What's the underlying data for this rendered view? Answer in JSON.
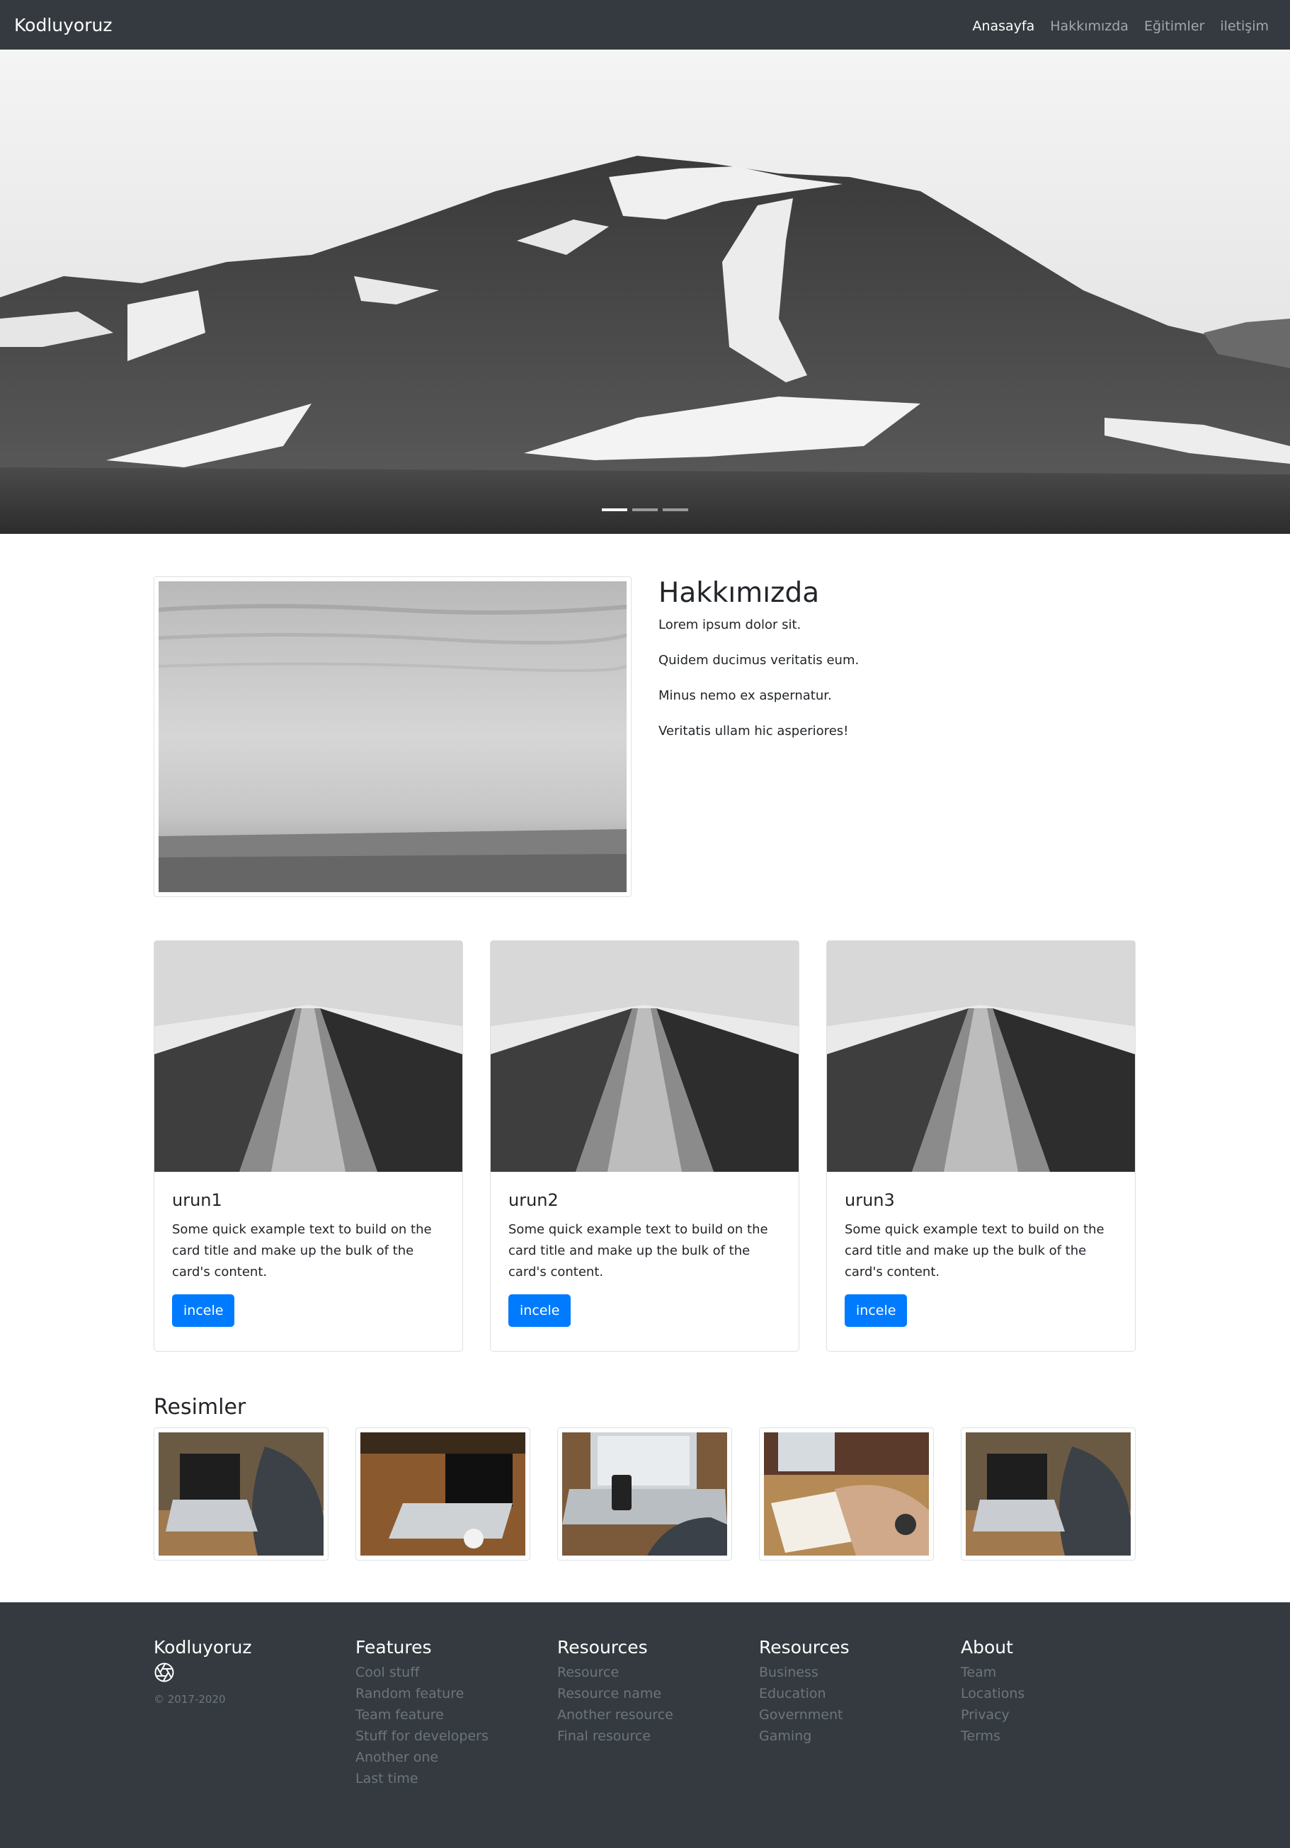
{
  "navbar": {
    "brand": "Kodluyoruz",
    "links": [
      {
        "label": "Anasayfa",
        "active": true
      },
      {
        "label": "Hakkımızda",
        "active": false
      },
      {
        "label": "Eğitimler",
        "active": false
      },
      {
        "label": "iletişim",
        "active": false
      }
    ]
  },
  "hero": {
    "slide_count": 3,
    "active_slide": 1
  },
  "about": {
    "title": "Hakkımızda",
    "lines": [
      "Lorem ipsum dolor sit.",
      "Quidem ducimus veritatis eum.",
      "Minus nemo ex aspernatur.",
      "Veritatis ullam hic asperiores!"
    ]
  },
  "cards": [
    {
      "title": "urun1",
      "text": "Some quick example text to build on the card title and make up the bulk of the card's content.",
      "button": "incele"
    },
    {
      "title": "urun2",
      "text": "Some quick example text to build on the card title and make up the bulk of the card's content.",
      "button": "incele"
    },
    {
      "title": "urun3",
      "text": "Some quick example text to build on the card title and make up the bulk of the card's content.",
      "button": "incele"
    }
  ],
  "gallery": {
    "title": "Resimler"
  },
  "footer": {
    "brand": "Kodluyoruz",
    "icon": "aperture-icon",
    "copyright": "© 2017-2020",
    "columns": [
      {
        "title": "Features",
        "links": [
          "Cool stuff",
          "Random feature",
          "Team feature",
          "Stuff for developers",
          "Another one",
          "Last time"
        ]
      },
      {
        "title": "Resources",
        "links": [
          "Resource",
          "Resource name",
          "Another resource",
          "Final resource"
        ]
      },
      {
        "title": "Resources",
        "links": [
          "Business",
          "Education",
          "Government",
          "Gaming"
        ]
      },
      {
        "title": "About",
        "links": [
          "Team",
          "Locations",
          "Privacy",
          "Terms"
        ]
      }
    ]
  },
  "colors": {
    "navbar_bg": "#343a40",
    "primary": "#007bff",
    "footer_link": "#6c757d"
  }
}
